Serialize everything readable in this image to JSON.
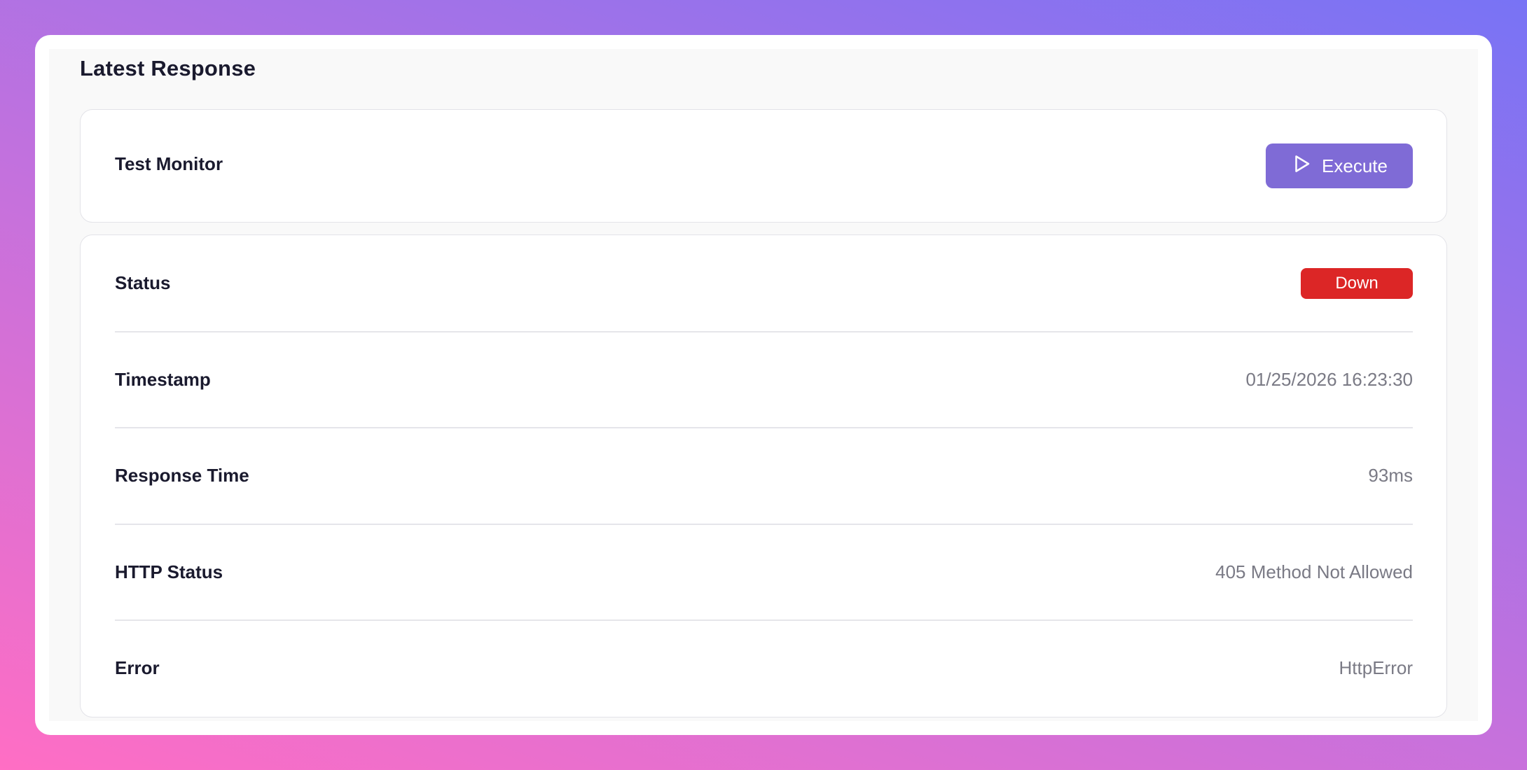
{
  "section": {
    "title": "Latest Response"
  },
  "monitor": {
    "name": "Test Monitor",
    "execute_label": "Execute",
    "execute_icon": "play-icon"
  },
  "details": {
    "status": {
      "label": "Status",
      "value": "Down",
      "color": "#dc2626"
    },
    "timestamp": {
      "label": "Timestamp",
      "value": "01/25/2026 16:23:30"
    },
    "response_time": {
      "label": "Response Time",
      "value": "93ms"
    },
    "http_status": {
      "label": "HTTP Status",
      "value": "405 Method Not Allowed"
    },
    "error": {
      "label": "Error",
      "value": "HttpError"
    }
  },
  "colors": {
    "accent": "#7f6bd6",
    "status_down": "#dc2626"
  }
}
